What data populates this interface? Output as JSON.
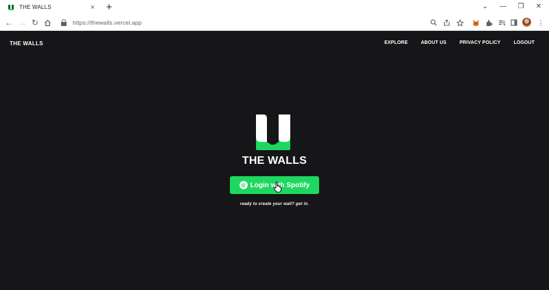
{
  "browser": {
    "tab": {
      "title": "THE WALLS",
      "close": "×"
    },
    "new_tab": "+",
    "window_controls": {
      "dropdown": "⌄",
      "minimize": "—",
      "restore": "❐",
      "close": "✕"
    },
    "url": "https://thewalls.vercel.app",
    "nav_glyphs": {
      "back": "←",
      "forward": "→",
      "reload": "↻"
    },
    "icons": [
      "search-icon",
      "share-icon",
      "star-icon",
      "metamask-icon",
      "extensions-icon",
      "reading-list-icon",
      "side-panel-icon",
      "profile-avatar",
      "kebab-menu-icon"
    ]
  },
  "site": {
    "brand": "THE WALLS",
    "nav": [
      {
        "label": "EXPLORE"
      },
      {
        "label": "ABOUT US"
      },
      {
        "label": "PRIVACY POLICY"
      },
      {
        "label": "LOGOUT"
      }
    ],
    "hero_title": "THE WALLS",
    "login_button": "Login with Spotify",
    "tagline": "ready to create your wall? get in.",
    "colors": {
      "background": "#161517",
      "accent": "#1ed760",
      "text": "#ffffff"
    }
  }
}
